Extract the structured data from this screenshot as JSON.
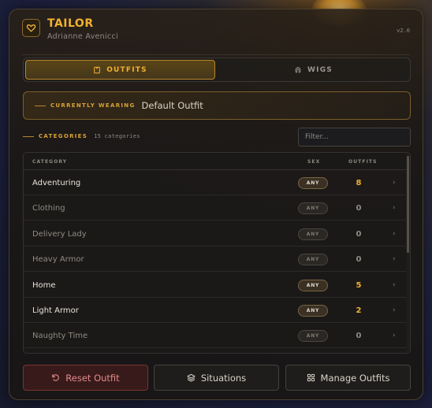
{
  "app": {
    "title": "TAILOR",
    "subtitle": "Adrianne Avenicci",
    "version": "v2.0"
  },
  "tabs": [
    {
      "label": "OUTFITS",
      "icon": "shirt-icon",
      "active": true
    },
    {
      "label": "WIGS",
      "icon": "wig-icon",
      "active": false
    }
  ],
  "current": {
    "label": "CURRENTLY WEARING",
    "value": "Default Outfit"
  },
  "categories": {
    "label": "CATEGORIES",
    "count": "15 categories",
    "filter_placeholder": "Filter..."
  },
  "table": {
    "headers": {
      "category": "CATEGORY",
      "sex": "SEX",
      "outfits": "OUTFITS"
    },
    "rows": [
      {
        "name": "Adventuring",
        "sex": "ANY",
        "count": "8",
        "active": true
      },
      {
        "name": "Clothing",
        "sex": "ANY",
        "count": "0",
        "active": false
      },
      {
        "name": "Delivery Lady",
        "sex": "ANY",
        "count": "0",
        "active": false
      },
      {
        "name": "Heavy Armor",
        "sex": "ANY",
        "count": "0",
        "active": false
      },
      {
        "name": "Home",
        "sex": "ANY",
        "count": "5",
        "active": true
      },
      {
        "name": "Light Armor",
        "sex": "ANY",
        "count": "2",
        "active": true
      },
      {
        "name": "Naughty Time",
        "sex": "ANY",
        "count": "0",
        "active": false
      }
    ]
  },
  "footer": {
    "reset": "Reset Outfit",
    "situations": "Situations",
    "manage": "Manage Outfits"
  },
  "colors": {
    "accent": "#f0b030",
    "danger": "#e38a8a"
  }
}
